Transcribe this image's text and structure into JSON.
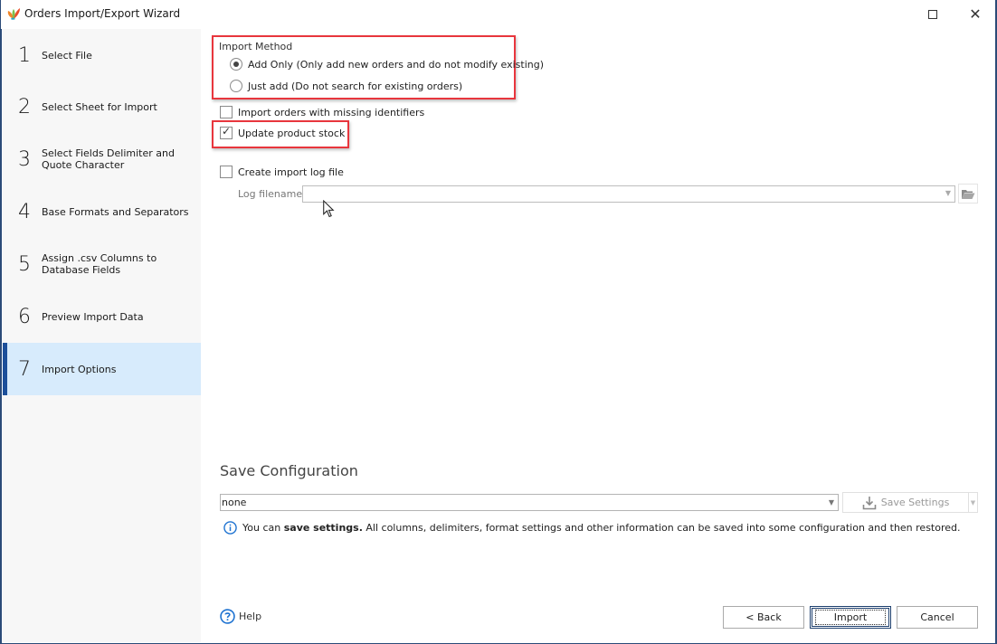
{
  "window": {
    "title": "Orders Import/Export Wizard",
    "controls": {
      "maximize": "maximize",
      "close": "close"
    },
    "accent_color": "#1c4f9a",
    "highlight_color": "#e8363d"
  },
  "sidebar": {
    "active_index": 6,
    "steps": [
      {
        "num": "1",
        "label": "Select File"
      },
      {
        "num": "2",
        "label": "Select Sheet for Import"
      },
      {
        "num": "3",
        "label": "Select Fields Delimiter and Quote Character"
      },
      {
        "num": "4",
        "label": "Base Formats and Separators"
      },
      {
        "num": "5",
        "label": "Assign .csv Columns to Database Fields"
      },
      {
        "num": "6",
        "label": "Preview Import Data"
      },
      {
        "num": "7",
        "label": "Import Options"
      }
    ]
  },
  "import_method": {
    "label": "Import Method",
    "options": [
      {
        "label": "Add Only (Only add new orders and do not modify existing)",
        "selected": true
      },
      {
        "label": "Just add (Do not search for existing orders)",
        "selected": false
      }
    ]
  },
  "options": {
    "missing_identifiers": {
      "label": "Import orders with missing identifiers",
      "checked": false
    },
    "update_stock": {
      "label": "Update product stock",
      "checked": true
    },
    "create_log": {
      "label": "Create import log file",
      "checked": false
    },
    "log_filename": {
      "label": "Log filename",
      "value": ""
    }
  },
  "save_configuration": {
    "title": "Save Configuration",
    "selected": "none",
    "save_button": "Save Settings",
    "info_prefix": "You can ",
    "info_bold": "save settings.",
    "info_rest": " All columns, delimiters, format settings and other information can be saved into some configuration and then restored."
  },
  "footer": {
    "help": "Help",
    "back": "< Back",
    "import": "Import",
    "cancel": "Cancel"
  }
}
